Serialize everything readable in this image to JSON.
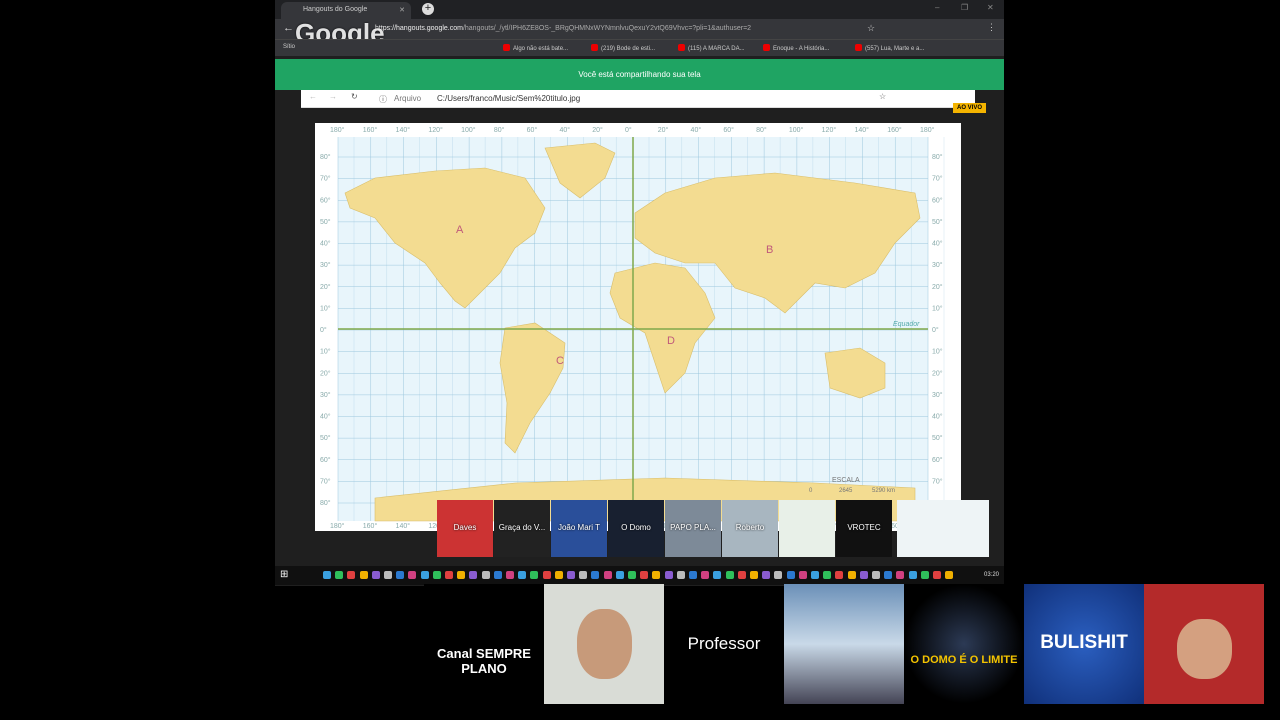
{
  "browser": {
    "tab_title": "Hangouts do Google",
    "url_host": "https://hangouts.google.com",
    "url_path": "/hangouts/_/ytl/IPH6ZE8OS-_BRgQHMNxWYNmnlvuQexuY2vtQ69Vhvc=?pli=1&authuser=2",
    "logo_text": "Google",
    "bookmarks": [
      "Sítio",
      "Algo não está bate...",
      "(219) Bode de esti...",
      "(115) A MARCA DA...",
      "Enoque - A História...",
      "(557) Lua, Marte e a..."
    ]
  },
  "banner": {
    "text": "Você está compartilhando sua tela"
  },
  "inner_browser": {
    "scheme_label": "Arquivo",
    "path": "C:/Users/franco/Music/Sem%20titulo.jpg"
  },
  "live_badge": "AO VIVO",
  "map": {
    "lon_labels": [
      "180°",
      "160°",
      "140°",
      "120°",
      "100°",
      "80°",
      "60°",
      "40°",
      "20°",
      "0°",
      "20°",
      "40°",
      "60°",
      "80°",
      "100°",
      "120°",
      "140°",
      "160°",
      "180°"
    ],
    "lat_labels": [
      "80°",
      "70°",
      "60°",
      "50°",
      "40°",
      "30°",
      "20°",
      "10°",
      "0°",
      "10°",
      "20°",
      "30°",
      "40°",
      "50°",
      "60°",
      "70°",
      "80°"
    ],
    "points": [
      "A",
      "B",
      "C",
      "D"
    ],
    "equator_label": "Equador",
    "scale_title": "ESCALA",
    "scale_values": [
      "0",
      "2645",
      "5290 km"
    ],
    "land_color": "#f3dc91",
    "water_color": "#e8f5fb",
    "grid_color": "#9cc7de"
  },
  "participants": [
    "Daves",
    "Graça do V...",
    "João Mari T",
    "O Domo",
    "PAPO PLA...",
    "Roberto",
    "",
    "VROTEC",
    ""
  ],
  "taskbar": {
    "time": "03:20"
  },
  "bottom_tiles": [
    "Canal SEMPRE PLANO",
    "",
    "Professor",
    "",
    "O DOMO É O LIMITE",
    "BULISHIT",
    ""
  ]
}
